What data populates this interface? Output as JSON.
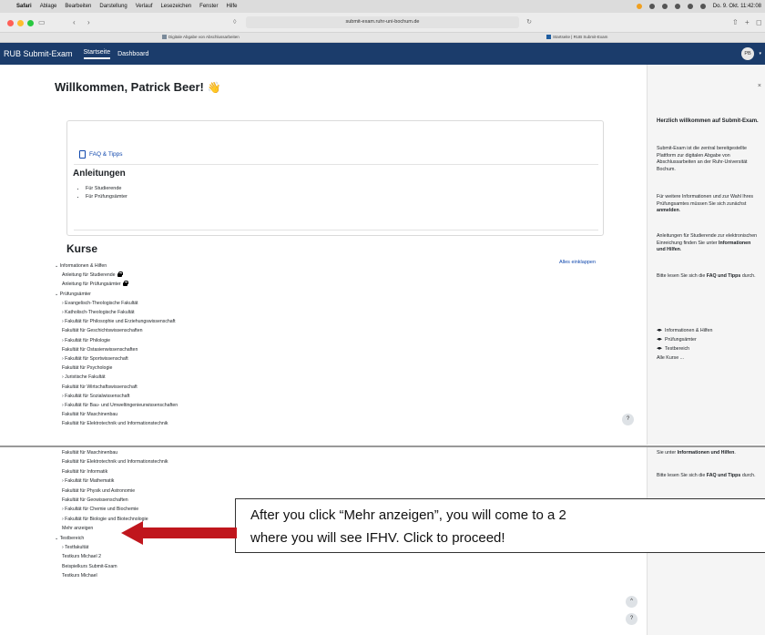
{
  "menubar": {
    "items": [
      "Safari",
      "Ablage",
      "Bearbeiten",
      "Darstellung",
      "Verlauf",
      "Lesezeichen",
      "Fenster",
      "Hilfe"
    ],
    "clock": "Do. 9. Okt. 11:42:08"
  },
  "browser": {
    "url": "submit-exam.ruhr-uni-bochum.de",
    "tabs": [
      "Digitale Abgabe von Abschlussarbeiten",
      "Startseite | RUB Submit-Exam"
    ]
  },
  "nav": {
    "brand": "RUB Submit-Exam",
    "links": [
      "Startseite",
      "Dashboard"
    ],
    "avatar_initials": "PB"
  },
  "main": {
    "welcome": "Willkommen, Patrick Beer!",
    "wave_emoji": "👋",
    "faq_link": "FAQ & Tipps",
    "anleitungen_title": "Anleitungen",
    "anleitungen": [
      "Für Studierende",
      "Für Prüfungsämter"
    ],
    "kurse_title": "Kurse",
    "collapse_all": "Alles einklappen"
  },
  "tree_top": [
    {
      "text": "Informationen & Hilfen",
      "prefix": "⌄"
    },
    {
      "text": "Anleitung für Studierende",
      "prefix": "",
      "lock": true
    },
    {
      "text": "Anleitung für Prüfungsämter",
      "prefix": "",
      "lock": true
    },
    {
      "text": "Prüfungsämter",
      "prefix": "⌄"
    },
    {
      "text": "Evangelisch-Theologische Fakultät",
      "prefix": "›"
    },
    {
      "text": "Katholisch-Theologische Fakultät",
      "prefix": "›"
    },
    {
      "text": "Fakultät für Philosophie und Erziehungswissenschaft",
      "prefix": "›"
    },
    {
      "text": "Fakultät für Geschichtswissenschaften",
      "prefix": ""
    },
    {
      "text": "Fakultät für Philologie",
      "prefix": "›"
    },
    {
      "text": "Fakultät für Ostasienwissenschaften",
      "prefix": ""
    },
    {
      "text": "Fakultät für Sportwissenschaft",
      "prefix": "›"
    },
    {
      "text": "Fakultät für Psychologie",
      "prefix": ""
    },
    {
      "text": "Juristische Fakultät",
      "prefix": "›"
    },
    {
      "text": "Fakultät für Wirtschaftswissenschaft",
      "prefix": ""
    },
    {
      "text": "Fakultät für Sozialwissenschaft",
      "prefix": "›"
    },
    {
      "text": "Fakultät für Bau- und Umweltingenieurwissenschaften",
      "prefix": "›"
    },
    {
      "text": "Fakultät für Maschinenbau",
      "prefix": ""
    },
    {
      "text": "Fakultät für Elektrotechnik und Informationstechnik",
      "prefix": ""
    }
  ],
  "drawer": {
    "heading": "Herzlich willkommen auf Submit-Exam.",
    "p1": "Submit-Exam ist die zentral bereitgestellte Plattform zur digitalen Abgabe von Abschlussarbeiten an der Ruhr-Universität Bochum.",
    "p2a": "Für weitere Informationen und zur Wahl Ihres Prüfungsamtes müssen Sie sich zunächst ",
    "p2b": "anmelden",
    "p2c": ".",
    "p3a": "Anleitungen für Studierende zur elektronischen Einreichung finden Sie unter ",
    "p3b": "Informationen und Hilfen",
    "p3c": ".",
    "p4a": "Bitte lesen Sie sich die ",
    "p4b": "FAQ und Tipps",
    "p4c": " durch.",
    "courses": [
      "Informationen & Hilfen",
      "Prüfungsämter",
      "Testbereich"
    ],
    "all_courses": "Alle Kurse ..."
  },
  "tree_bottom": [
    {
      "text": "Fakultät für Maschinenbau",
      "prefix": ""
    },
    {
      "text": "Fakultät für Elektrotechnik und Informationstechnik",
      "prefix": ""
    },
    {
      "text": "Fakultät für Informatik",
      "prefix": ""
    },
    {
      "text": "Fakultät für Mathematik",
      "prefix": "›"
    },
    {
      "text": "Fakultät für Physik und Astronomie",
      "prefix": ""
    },
    {
      "text": "Fakultät für Geowissenschaften",
      "prefix": ""
    },
    {
      "text": "Fakultät für Chemie und Biochemie",
      "prefix": "›"
    },
    {
      "text": "Fakultät für Biologie und Biotechnologie",
      "prefix": "›"
    },
    {
      "text": "Mehr anzeigen",
      "prefix": ""
    },
    {
      "text": "Testbereich",
      "prefix": "⌄"
    },
    {
      "text": "Testfakultät",
      "prefix": "›"
    },
    {
      "text": "Testkurs Michael 2",
      "prefix": ""
    },
    {
      "text": "Beispielkurs Submit-Exam",
      "prefix": ""
    },
    {
      "text": "Testkurs Michael",
      "prefix": ""
    }
  ],
  "drawer_bottom": {
    "p3a": "Sie unter ",
    "p3b": "Informationen und Hilfen",
    "p3c": ".",
    "p4a": "Bitte lesen Sie sich die ",
    "p4b": "FAQ und Tipps",
    "p4c": " durch."
  },
  "callout": {
    "line1": "After you click “Mehr anzeigen”, you will come to a 2",
    "line2": "where you will see IFHV. Click to proceed!"
  },
  "help_label": "?",
  "up_label": "^"
}
